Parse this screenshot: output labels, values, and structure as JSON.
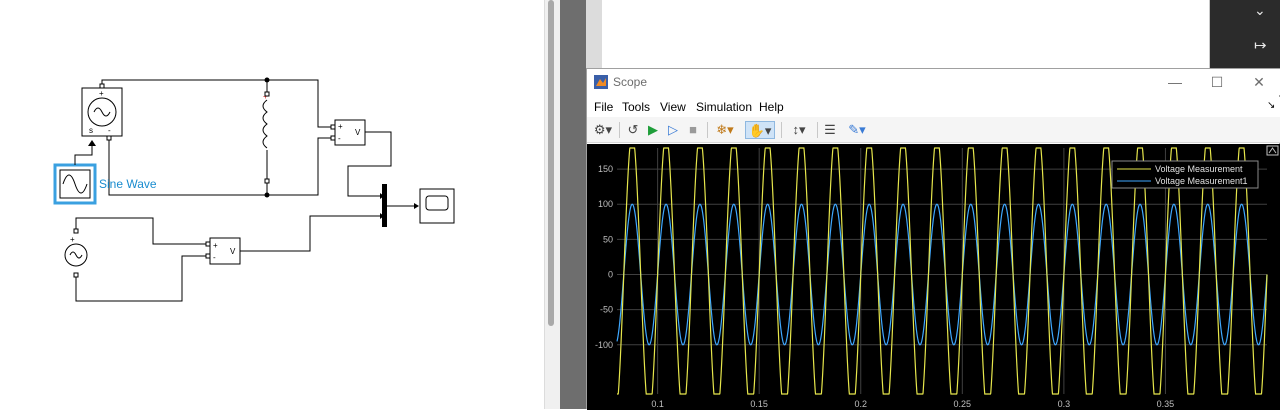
{
  "model": {
    "blocks": {
      "sine_wave_label": "Sine Wave",
      "vm_label": "V",
      "plus": "+",
      "minus": "-",
      "source_plus": "+",
      "source_s": "s",
      "source_dash": "-"
    }
  },
  "scope": {
    "title": "Scope",
    "window_controls": {
      "minimize": "—",
      "maximize": "☐",
      "close": "✕"
    },
    "menu": [
      "File",
      "Tools",
      "View",
      "Simulation",
      "Help"
    ],
    "icons": [
      "settings-icon",
      "step-back-icon",
      "run-icon",
      "step-forward-icon",
      "stop-icon",
      "highlight-icon",
      "pan-icon",
      "zoom-icon",
      "autoscale-icon",
      "triggers-icon",
      "measure-icon"
    ],
    "colors": {
      "background": "#000000",
      "grid": "#404040",
      "series1": "#e6e64c",
      "series2": "#3fa8ff"
    }
  },
  "chart_data": {
    "type": "line",
    "series": [
      {
        "name": "Voltage Measurement",
        "amplitude": 200,
        "frequency_hz": 60
      },
      {
        "name": "Voltage Measurement1",
        "amplitude": 100,
        "frequency_hz": 60
      }
    ],
    "x_ticks": [
      "0.1",
      "0.15",
      "0.2",
      "0.25",
      "0.3",
      "0.35"
    ],
    "x_tick_values": [
      0.1,
      0.15,
      0.2,
      0.25,
      0.3,
      0.35
    ],
    "y_ticks": [
      "150",
      "100",
      "50",
      "0",
      "-50",
      "-100"
    ],
    "y_tick_values": [
      150,
      100,
      50,
      0,
      -50,
      -100
    ],
    "xlim": [
      0.08,
      0.4
    ],
    "ylim": [
      -170,
      180
    ],
    "grid": true,
    "legend_position": "top-right"
  }
}
